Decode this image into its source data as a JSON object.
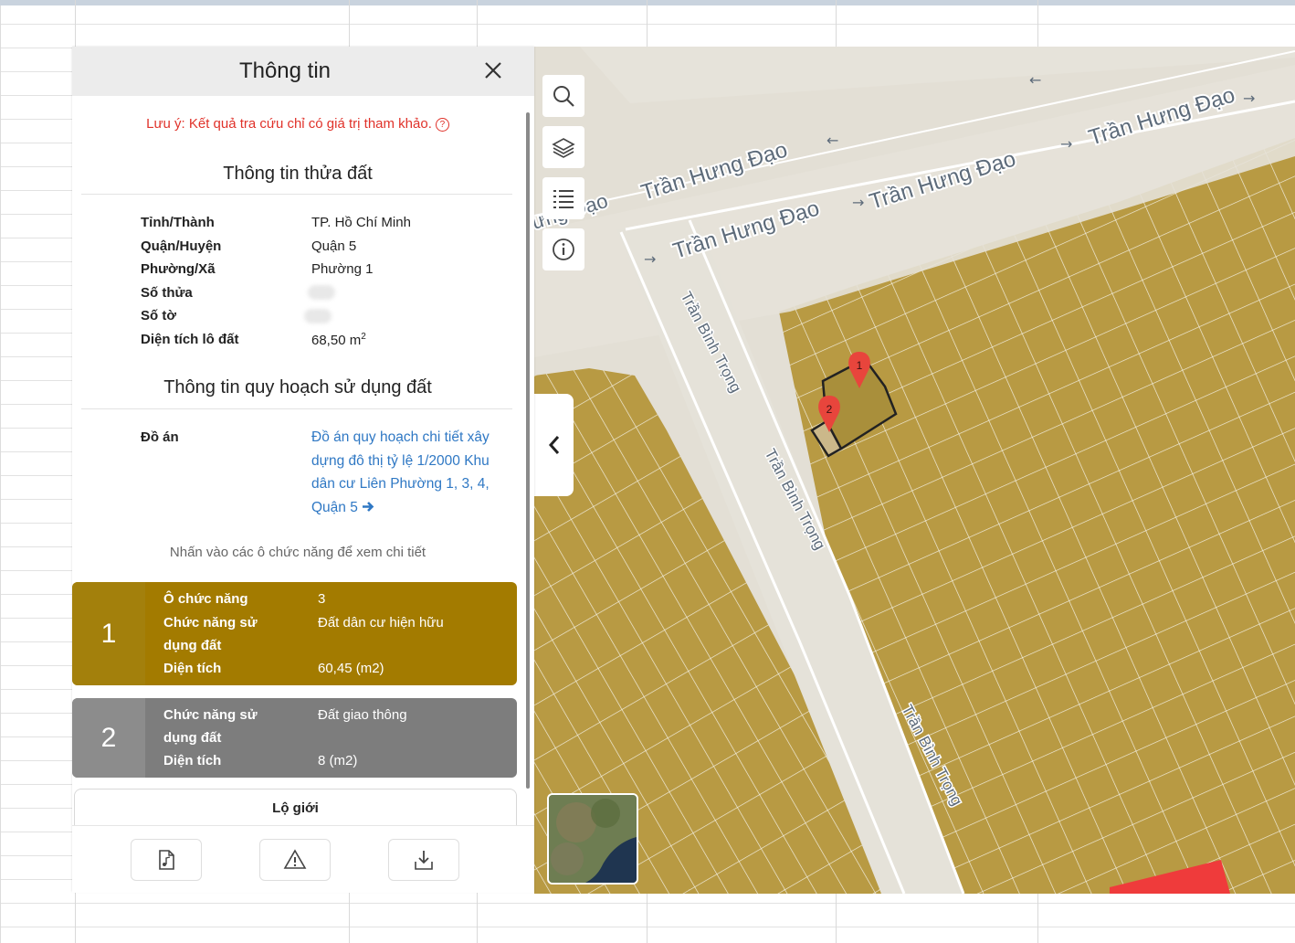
{
  "panel": {
    "title": "Thông tin",
    "warning": "Lưu ý: Kết quả tra cứu chỉ có giá trị tham khảo.",
    "warning_icon": "?",
    "land_section_title": "Thông tin thửa đất",
    "land_info": [
      {
        "label": "Tỉnh/Thành",
        "value": "TP. Hồ Chí Minh"
      },
      {
        "label": "Quận/Huyện",
        "value": "Quận 5"
      },
      {
        "label": "Phường/Xã",
        "value": "Phường 1"
      },
      {
        "label": "Số thửa",
        "value": ""
      },
      {
        "label": "Số tờ",
        "value": ""
      },
      {
        "label": "Diện tích lô đất",
        "value": "68,50 m",
        "unit_sup": "2"
      }
    ],
    "planning_section_title": "Thông tin quy hoạch sử dụng đất",
    "project_label": "Đồ án",
    "project_link": "Đồ án quy hoạch chi tiết xây dựng đô thị tỷ lệ 1/2000 Khu dân cư Liên Phường 1, 3, 4, Quận 5",
    "hint": "Nhấn vào các ô chức năng để xem chi tiết",
    "cards": [
      {
        "number": "1",
        "color": "#a37b00",
        "rows": [
          {
            "label": "Ô chức năng",
            "value": "3"
          },
          {
            "label": "Chức năng sử dụng đất",
            "value": "Đất dân cư hiện hữu"
          },
          {
            "label": "Diện tích",
            "value": "60,45 (m2)"
          }
        ]
      },
      {
        "number": "2",
        "color": "#7d7d7d",
        "rows": [
          {
            "label": "Chức năng sử dụng đất",
            "value": "Đất giao thông"
          },
          {
            "label": "Diện tích",
            "value": "8 (m2)"
          }
        ]
      }
    ],
    "card_labels": {
      "chuc_nang_l1": "Chức năng sử",
      "chuc_nang_l2": "dụng đất"
    },
    "lo_gioi": "Lộ giới",
    "footer_buttons": [
      "document-music-icon",
      "warning-triangle-icon",
      "download-icon"
    ]
  },
  "map": {
    "street_main": "Trần Hưng Đạo",
    "street_side": "Trần Bình Trọng",
    "street_partial": "ưng Đạo",
    "tools": [
      "search-icon",
      "layers-icon",
      "list-icon",
      "info-icon"
    ],
    "markers": [
      "1",
      "2"
    ],
    "parcel_color": "#b89a43",
    "road_color": "#e5e2d9"
  }
}
